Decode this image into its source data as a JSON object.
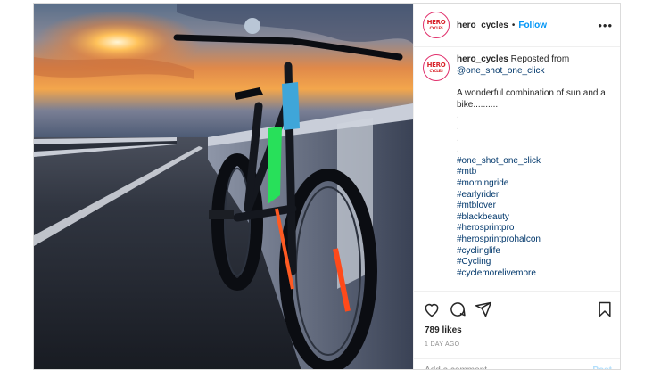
{
  "post": {
    "account": {
      "username": "hero_cycles",
      "avatar_logo_top": "HERO",
      "avatar_logo_bottom": "CYCLES",
      "follow_label": "Follow",
      "separator": "•",
      "more_label": "•••"
    },
    "photo": {
      "description_icon": "bicycle-sunset-photo"
    },
    "caption": {
      "username": "hero_cycles",
      "reposted_text": "Reposted from",
      "source_handle": "@one_shot_one_click",
      "text": "A wonderful combination of sun and a bike..........",
      "dots": [
        ".",
        ".",
        ".",
        "."
      ],
      "hashtags": [
        "#one_shot_one_click",
        "#mtb",
        "#morningride",
        "#earlyrider",
        "#mtblover",
        "#blackbeauty",
        "#herosprintpro",
        "#herosprintprohalcon",
        "#cyclinglife",
        "#Cycling",
        "#cyclemorelivemore"
      ]
    },
    "actions": {
      "icons": [
        "heart-icon",
        "comment-icon",
        "share-icon",
        "bookmark-icon"
      ]
    },
    "likes_text": "789 likes",
    "date_text": "1 DAY AGO",
    "comment": {
      "placeholder": "Add a comment...",
      "post_label": "Post"
    },
    "colors": {
      "link": "#00376b",
      "follow": "#0095f6",
      "brand_red": "#d8232a"
    }
  }
}
